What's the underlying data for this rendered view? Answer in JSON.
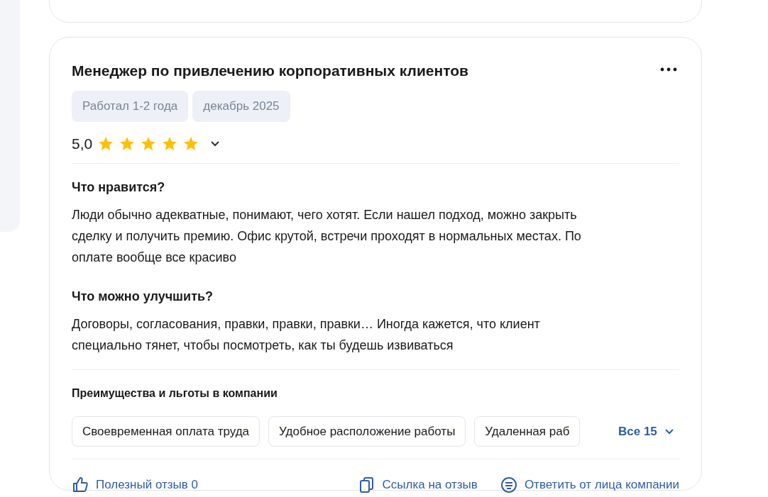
{
  "review": {
    "title": "Менеджер по привлечению корпоративных клиентов",
    "tags": [
      "Работал 1-2 года",
      "декабрь 2025"
    ],
    "rating": "5,0",
    "stars": 5,
    "sections": [
      {
        "heading": "Что нравится?",
        "text": "Люди обычно адекватные, понимают, чего хотят. Если нашел подход, можно закрыть сделку и получить премию. Офис крутой, встречи проходят в нормальных местах. По оплате вообще все красиво"
      },
      {
        "heading": "Что можно улучшить?",
        "text": "Договоры, согласования, правки, правки, правки… Иногда кажется, что клиент специально тянет, чтобы посмотреть, как ты будешь извиваться"
      }
    ],
    "benefits_title": "Преимущества и льготы в компании",
    "benefits": [
      "Своевременная оплата труда",
      "Удобное расположение работы",
      "Удаленная раб"
    ],
    "benefits_more": "Все 15",
    "actions": [
      {
        "kind": "like",
        "label": "Полезный отзыв 0"
      },
      {
        "kind": "link",
        "label": "Ссылка на отзыв"
      },
      {
        "kind": "reply",
        "label": "Ответить от лица компании"
      }
    ]
  }
}
